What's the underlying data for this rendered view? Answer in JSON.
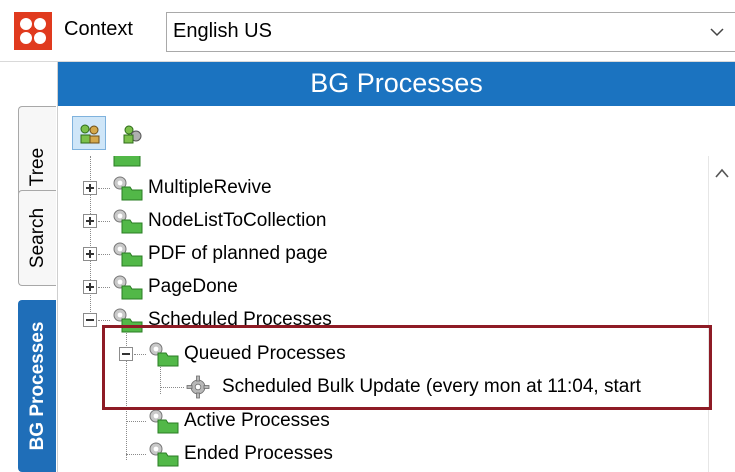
{
  "context": {
    "label": "Context",
    "value": "English US"
  },
  "tabs": {
    "tree": "Tree",
    "search": "Search",
    "bg_processes": "BG Processes"
  },
  "header": {
    "title": "BG Processes"
  },
  "toolbar": {
    "buttons": [
      {
        "name": "process-group-icon",
        "active": true
      },
      {
        "name": "process-user-icon",
        "active": false
      }
    ]
  },
  "tree": {
    "items": [
      {
        "label": "MultipleRevive",
        "expander": "plus"
      },
      {
        "label": "NodeListToCollection",
        "expander": "plus"
      },
      {
        "label": "PDF of planned page",
        "expander": "plus"
      },
      {
        "label": "PageDone",
        "expander": "plus"
      },
      {
        "label": "Scheduled Processes",
        "expander": "minus"
      },
      {
        "label": "Queued Processes",
        "expander": "minus"
      },
      {
        "label": "Scheduled Bulk Update (every mon at 11:04, start",
        "expander": "none"
      },
      {
        "label": "Active Processes",
        "expander": "none"
      },
      {
        "label": "Ended Processes",
        "expander": "none"
      }
    ]
  },
  "colors": {
    "header_blue": "#1b73c0",
    "highlight_border": "#8e1b25",
    "logo_red": "#e03a1e"
  }
}
